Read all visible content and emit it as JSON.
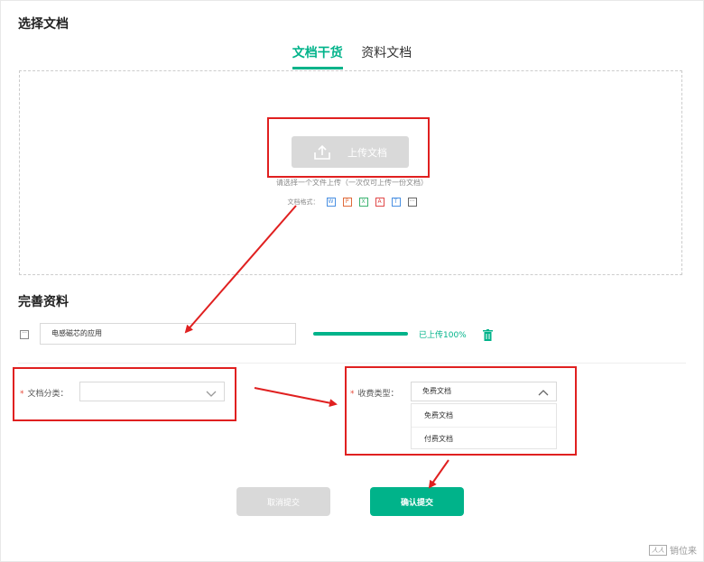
{
  "section1": {
    "title": "选择文档"
  },
  "tabs": [
    {
      "label": "文档干货",
      "active": true
    },
    {
      "label": "资料文档",
      "active": false
    }
  ],
  "upload": {
    "button_label": "上传文档",
    "hint": "请选择一个文件上传（一次仅可上传一份文档）",
    "formats_label": "文档格式：",
    "formats": [
      {
        "letter": "W",
        "color": "#4a90e2"
      },
      {
        "letter": "P",
        "color": "#e06a3a"
      },
      {
        "letter": "X",
        "color": "#3cb371"
      },
      {
        "letter": "A",
        "color": "#e04848"
      },
      {
        "letter": "T",
        "color": "#4a90e2"
      },
      {
        "letter": "···",
        "color": "#666666"
      }
    ]
  },
  "section2": {
    "title": "完善资料"
  },
  "file": {
    "icon_text": "···",
    "name": "电感磁芯的应用",
    "progress": 100,
    "progress_text": "已上传100%"
  },
  "category": {
    "required_mark": "*",
    "label": "文档分类：",
    "value": ""
  },
  "fee": {
    "required_mark": "*",
    "label": "收费类型：",
    "value": "免费文档",
    "options": [
      "免费文档",
      "付费文档"
    ]
  },
  "actions": {
    "cancel_label": "取消提交",
    "confirm_label": "确认提交"
  },
  "watermark": {
    "badge": "人人",
    "text": "销位来"
  },
  "colors": {
    "accent": "#00b38a",
    "annotation": "#e02020"
  }
}
